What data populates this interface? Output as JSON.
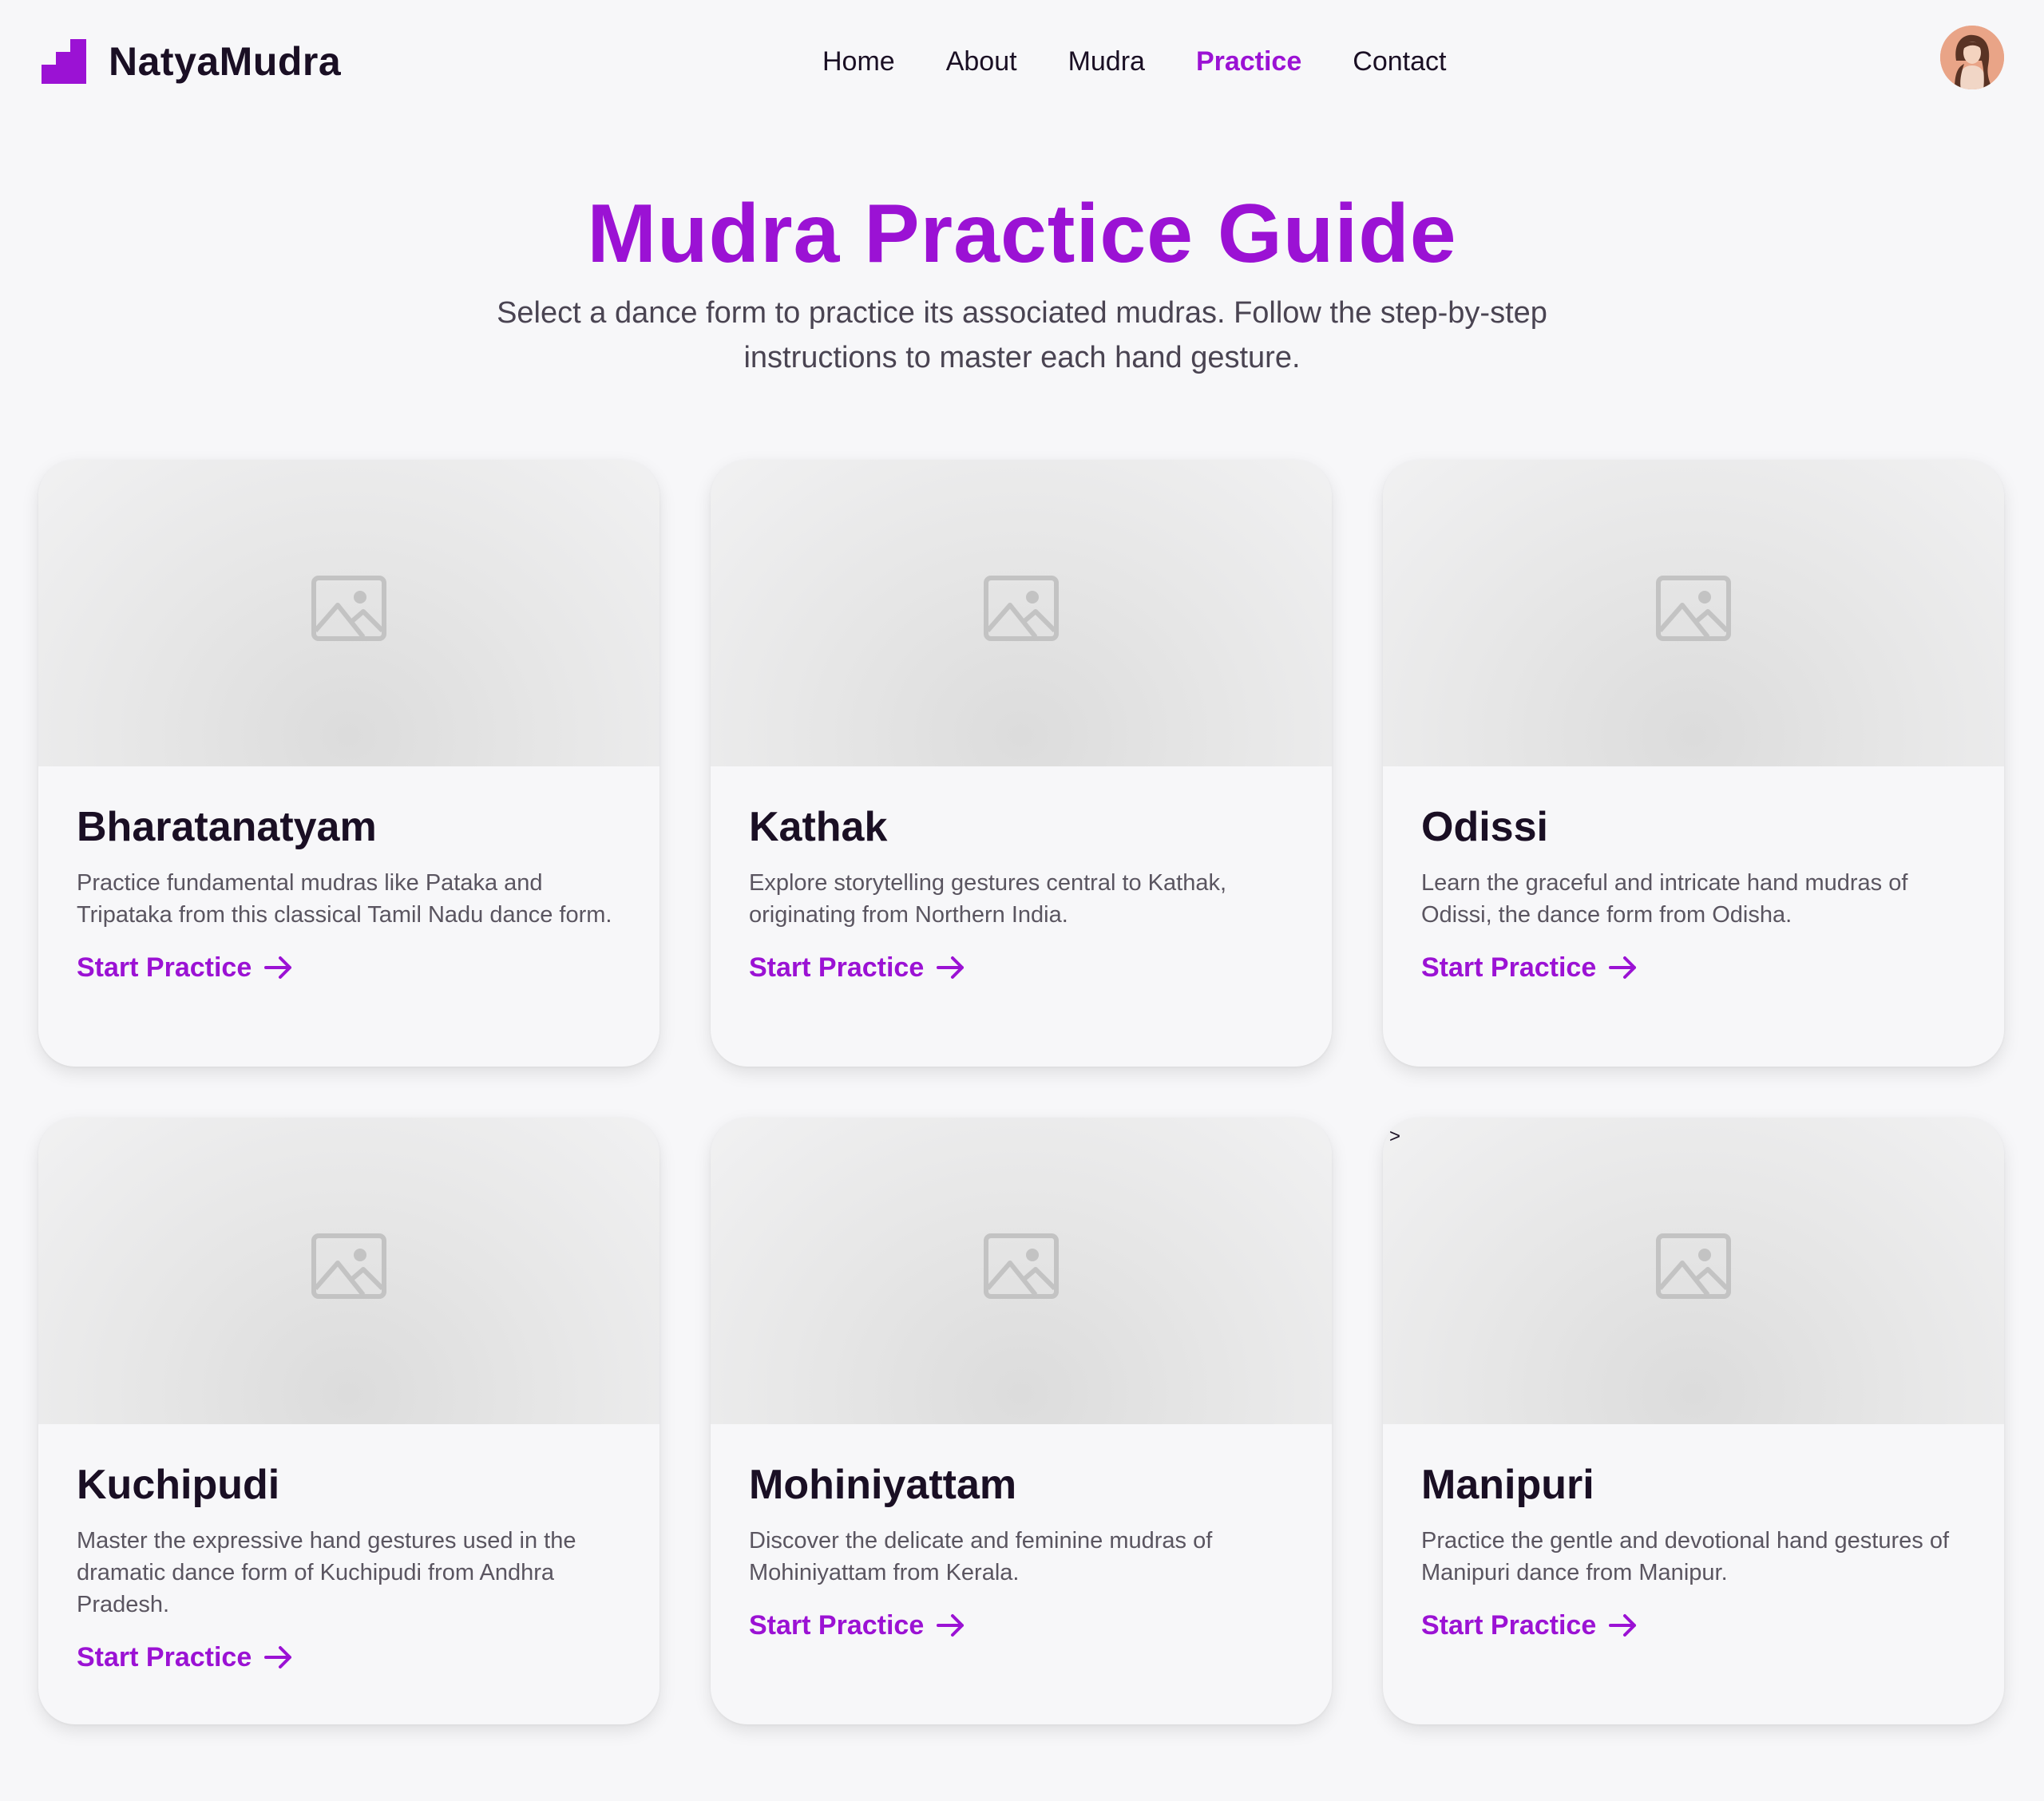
{
  "brand": {
    "name": "NatyaMudra",
    "accent_color": "#9b12d4"
  },
  "nav": {
    "items": [
      {
        "label": "Home",
        "active": false
      },
      {
        "label": "About",
        "active": false
      },
      {
        "label": "Mudra",
        "active": false
      },
      {
        "label": "Practice",
        "active": true
      },
      {
        "label": "Contact",
        "active": false
      }
    ]
  },
  "avatar": {
    "icon": "user-avatar"
  },
  "hero": {
    "title": "Mudra Practice Guide",
    "subtitle": "Select a dance form to practice its associated mudras. Follow the step-by-step instructions to master each hand gesture."
  },
  "cards": [
    {
      "title": "Bharatanatyam",
      "description": "Practice fundamental mudras like Pataka and Tripataka from this classical Tamil Nadu dance form.",
      "cta": "Start Practice"
    },
    {
      "title": "Kathak",
      "description": "Explore storytelling gestures central to Kathak, originating from Northern India.",
      "cta": "Start Practice"
    },
    {
      "title": "Odissi",
      "description": "Learn the graceful and intricate hand mudras of Odissi, the dance form from Odisha.",
      "cta": "Start Practice"
    },
    {
      "title": "Kuchipudi",
      "description": "Master the expressive hand gestures used in the dramatic dance form of Kuchipudi from Andhra Pradesh.",
      "cta": "Start Practice"
    },
    {
      "title": "Mohiniyattam",
      "description": "Discover the delicate and feminine mudras of Mohiniyattam from Kerala.",
      "cta": "Start Practice"
    },
    {
      "title": "Manipuri",
      "description": "Practice the gentle and devotional hand gestures of Manipuri dance from Manipur.",
      "cta": "Start Practice"
    }
  ],
  "stray_glyph": ">"
}
